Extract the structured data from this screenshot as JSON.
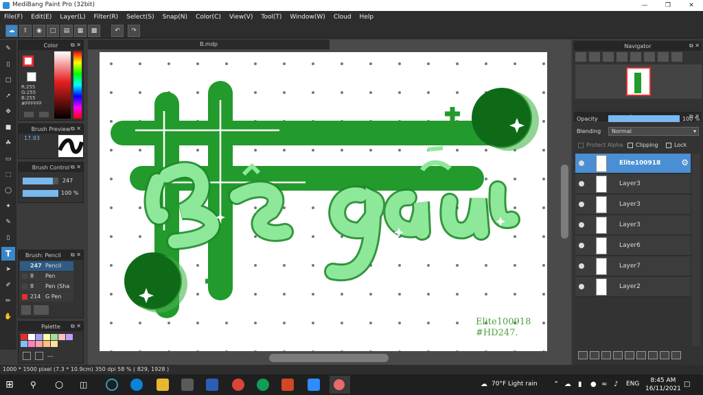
{
  "app": {
    "title": "MediBang Paint Pro (32bit)"
  },
  "menu": [
    "File(F)",
    "Edit(E)",
    "Layer(L)",
    "Filter(R)",
    "Select(S)",
    "Snap(N)",
    "Color(C)",
    "View(V)",
    "Tool(T)",
    "Window(W)",
    "Cloud",
    "Help"
  ],
  "document": {
    "tab_label": "B.mdp"
  },
  "color_panel": {
    "title": "Color",
    "r": "R:255",
    "g": "G:255",
    "b": "B:255",
    "hex": "#FFFFFF"
  },
  "brush_preview": {
    "title": "Brush Preview",
    "size": "17.93"
  },
  "brush_control": {
    "title": "Brush Control",
    "size": "247",
    "opacity": "100 %",
    "size_fill": 0.85,
    "opacity_fill": 1.0
  },
  "brush_list": {
    "title": "Brush: Pencil",
    "items": [
      {
        "size": "247",
        "name": "Pencil",
        "selected": true,
        "color": "#2f5b85"
      },
      {
        "size": "8",
        "name": "Pen",
        "selected": false,
        "color": "#444"
      },
      {
        "size": "8",
        "name": "Pen (Sha",
        "selected": false,
        "color": "#444"
      },
      {
        "size": "214",
        "name": "G Pen",
        "selected": false,
        "color": "#e53030"
      }
    ]
  },
  "palette": {
    "title": "Palette",
    "dash": "---",
    "colors": [
      "#e53030",
      "#ffffff",
      "#a0a0ff",
      "#ffffaa",
      "#a0e0a0",
      "#ffc0c0",
      "#c0a0ff",
      "#80c0ff",
      "#ff80c0",
      "#ffa0a0",
      "#ffc080",
      "#ffe0a0"
    ]
  },
  "navigator": {
    "title": "Navigator"
  },
  "layer_panel": {
    "title": "Layer",
    "opacity_label": "Opacity",
    "opacity_value": "100 %",
    "opacity_fill": 1.0,
    "blending_label": "Blending",
    "blending_value": "Normal",
    "protect_alpha": "Protect Alpha",
    "clipping": "Clipping",
    "lock": "Lock",
    "layers": [
      {
        "name": "Elite100918",
        "selected": true
      },
      {
        "name": "Layer3",
        "selected": false
      },
      {
        "name": "Layer3",
        "selected": false
      },
      {
        "name": "Layer3",
        "selected": false
      },
      {
        "name": "Layer6",
        "selected": false
      },
      {
        "name": "Layer7",
        "selected": false
      },
      {
        "name": "Layer2",
        "selected": false
      }
    ]
  },
  "artwork": {
    "signature_line1": "Elite100918",
    "signature_line2": "#HD247.",
    "lettering": "Bé gấu"
  },
  "statusbar": {
    "text": "1000 * 1500 pixel  (7.3 * 10.9cm)  350 dpi  58 %  ( 829, 1928 )"
  },
  "taskbar": {
    "weather": "70°F  Light rain",
    "language": "ENG",
    "time": "8:45 AM",
    "date": "16/11/2021"
  },
  "colors": {
    "accent": "#4a8fd4",
    "green_dark": "#1e8a2a",
    "green_light": "#8ee89a"
  }
}
